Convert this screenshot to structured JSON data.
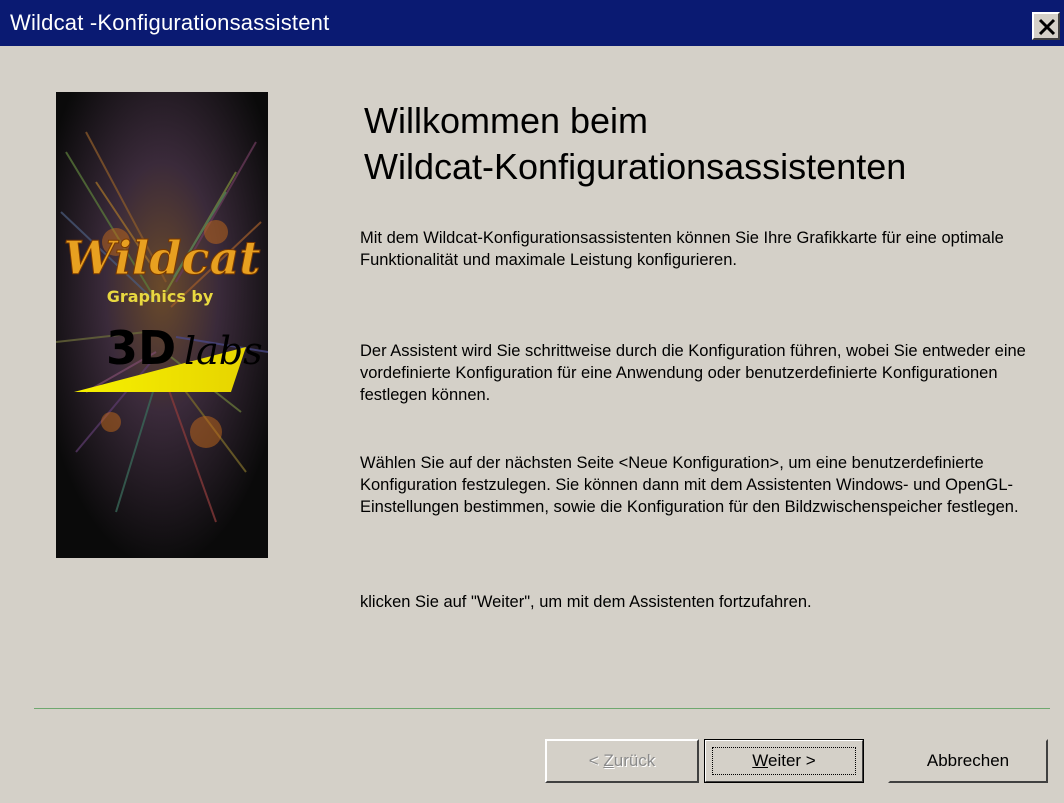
{
  "window": {
    "title": "Wildcat -Konfigurationsassistent",
    "close_icon": "close-icon"
  },
  "banner": {
    "brand_text": "Wildcat",
    "subtitle_text": "Graphics by",
    "maker_text_3d": "3D",
    "maker_text_labs": "labs"
  },
  "content": {
    "heading_line1": "Willkommen beim",
    "heading_line2": "Wildcat-Konfigurationsassistenten",
    "paragraph1": "Mit dem Wildcat-Konfigurationsassistenten können Sie Ihre Grafikkarte für eine optimale Funktionalität und maximale Leistung konfigurieren.",
    "paragraph2": "Der Assistent wird Sie schrittweise durch die Konfiguration führen, wobei Sie entweder eine vordefinierte Konfiguration für eine Anwendung oder benutzerdefinierte Konfigurationen festlegen können.",
    "paragraph3": "Wählen Sie auf der nächsten Seite <Neue Konfiguration>, um eine benutzerdefinierte Konfiguration festzulegen. Sie können dann mit dem Assistenten Windows- und OpenGL-Einstellungen bestimmen, sowie die Konfiguration für den Bildzwischenspeicher festlegen.",
    "paragraph4": "klicken Sie auf \"Weiter\", um mit dem Assistenten fortzufahren."
  },
  "buttons": {
    "back_prefix": "< ",
    "back_mnemonic": "Z",
    "back_rest": "urück",
    "next_mnemonic": "W",
    "next_rest": "eiter >",
    "cancel_label": "Abbrechen"
  },
  "colors": {
    "titlebar": "#0a1a72",
    "dialog_background": "#d4d0c8",
    "separator": "#6fa86f",
    "disabled_text": "#8a8a8a"
  }
}
